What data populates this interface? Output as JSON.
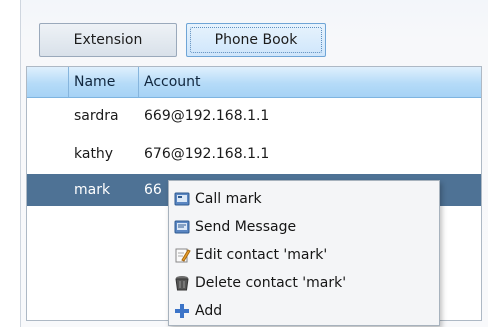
{
  "tabs": [
    {
      "label": "Extension",
      "active": false
    },
    {
      "label": "Phone Book",
      "active": true
    }
  ],
  "table": {
    "columns": [
      "",
      "Name",
      "Account"
    ],
    "rows": [
      {
        "name": "sardra",
        "account": "669@192.168.1.1"
      },
      {
        "name": "kathy",
        "account": "676@192.168.1.1"
      },
      {
        "name": "mark",
        "account": "66",
        "selected": true
      }
    ]
  },
  "context_menu": {
    "items": [
      {
        "label": "Call mark",
        "icon": "call-icon"
      },
      {
        "label": "Send Message",
        "icon": "message-icon"
      },
      {
        "label": "Edit contact 'mark'",
        "icon": "edit-icon"
      },
      {
        "label": "Delete contact 'mark'",
        "icon": "trash-icon"
      },
      {
        "label": "Add",
        "icon": "add-icon"
      }
    ]
  },
  "colors": {
    "selection": "#4e7295",
    "header": "#b5dbf8",
    "accent_border": "#6fa5d6"
  }
}
